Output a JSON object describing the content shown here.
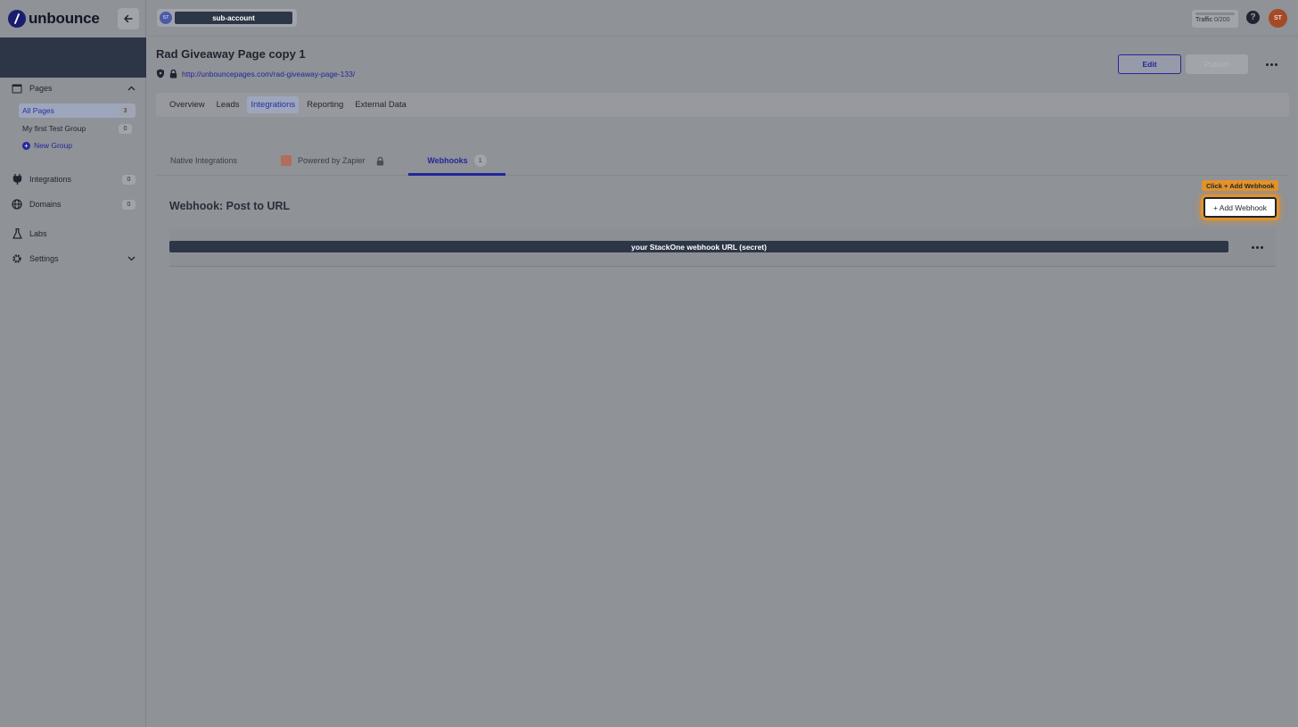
{
  "brand": {
    "name": "unbounce"
  },
  "topbar": {
    "account_initials": "ST",
    "account_name": "sub-account",
    "traffic_label": "Traffic",
    "traffic_value": "0/200",
    "help_label": "?",
    "user_initials": "ST"
  },
  "sidebar": {
    "pages_label": "Pages",
    "all_pages": {
      "label": "All Pages",
      "count": "3"
    },
    "group": {
      "label": "My first Test Group",
      "count": "0"
    },
    "new_group_label": "New Group",
    "integrations": {
      "label": "Integrations",
      "count": "0"
    },
    "domains": {
      "label": "Domains",
      "count": "0"
    },
    "labs_label": "Labs",
    "settings_label": "Settings"
  },
  "page": {
    "title": "Rad Giveaway Page copy 1",
    "url": "http://unbouncepages.com/rad-giveaway-page-133/",
    "edit_label": "Edit",
    "publish_label": "Publish"
  },
  "tabs": [
    "Overview",
    "Leads",
    "Integrations",
    "Reporting",
    "External Data"
  ],
  "subtabs": {
    "native": "Native Integrations",
    "zapier": "Powered by Zapier",
    "webhooks": "Webhooks",
    "webhooks_count": "1"
  },
  "webhooks": {
    "section_title": "Webhook: Post to URL",
    "tooltip": "Click + Add Webhook",
    "add_label": "+ Add Webhook",
    "rows": [
      {
        "url": "your StackOne webhook URL (secret)"
      }
    ]
  },
  "colors": {
    "accent": "#23279a",
    "highlight": "#e3922a",
    "avatar": "#a44a27",
    "banner": "#2d3647"
  }
}
